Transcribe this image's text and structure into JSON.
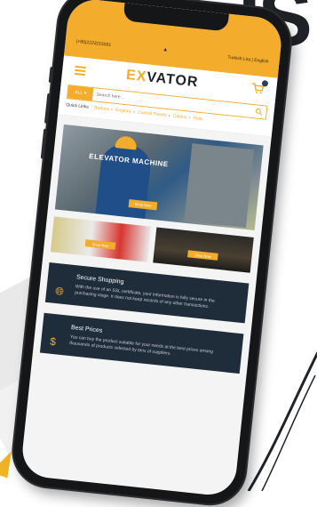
{
  "backdrop": {
    "headline": "IS"
  },
  "phone": {
    "topbar": {
      "phone_number": "(+90)2223215551",
      "language": "Turkish Lira | English"
    },
    "header": {
      "logo_part1": "EX",
      "logo_part2": "VATOR",
      "menu_icon": "hamburger-icon",
      "cart_icon": "cart-icon"
    },
    "search": {
      "category": "ALL",
      "placeholder": "Search here..."
    },
    "quick_links": {
      "title": "Quick Links",
      "items": [
        "Buttons",
        "Engines",
        "Control Panels",
        "Cabins",
        "Rails"
      ]
    },
    "hero": {
      "title": "ELEVATOR MACHINE",
      "button": "Shop Now"
    },
    "promos": [
      {
        "button": "Shop Now"
      },
      {
        "button": "Shop Now"
      }
    ],
    "features": [
      {
        "icon": "globe-icon",
        "title": "Secure Shopping",
        "text": "With the use of an SSL certificate, your information is fully secure in the purchasing stage. It does not keep records of any other transactions."
      },
      {
        "icon": "dollar-icon",
        "title": "Best Prices",
        "text": "You can buy the product suitable for your needs at the best prices among thousands of products selected by tens of suppliers."
      }
    ]
  },
  "colors": {
    "accent": "#f3ac2c",
    "dark": "#1f2d3a"
  }
}
